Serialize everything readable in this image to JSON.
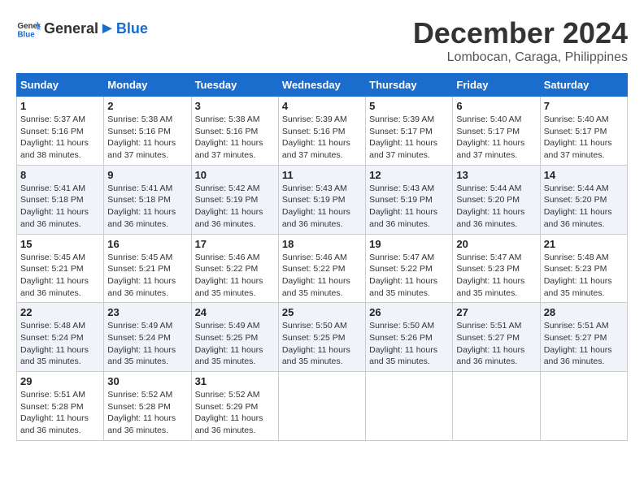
{
  "header": {
    "logo_general": "General",
    "logo_blue": "Blue",
    "month_year": "December 2024",
    "location": "Lombocan, Caraga, Philippines"
  },
  "days_of_week": [
    "Sunday",
    "Monday",
    "Tuesday",
    "Wednesday",
    "Thursday",
    "Friday",
    "Saturday"
  ],
  "weeks": [
    [
      {
        "day": "1",
        "sunrise": "5:37 AM",
        "sunset": "5:16 PM",
        "daylight": "11 hours and 38 minutes."
      },
      {
        "day": "2",
        "sunrise": "5:38 AM",
        "sunset": "5:16 PM",
        "daylight": "11 hours and 37 minutes."
      },
      {
        "day": "3",
        "sunrise": "5:38 AM",
        "sunset": "5:16 PM",
        "daylight": "11 hours and 37 minutes."
      },
      {
        "day": "4",
        "sunrise": "5:39 AM",
        "sunset": "5:16 PM",
        "daylight": "11 hours and 37 minutes."
      },
      {
        "day": "5",
        "sunrise": "5:39 AM",
        "sunset": "5:17 PM",
        "daylight": "11 hours and 37 minutes."
      },
      {
        "day": "6",
        "sunrise": "5:40 AM",
        "sunset": "5:17 PM",
        "daylight": "11 hours and 37 minutes."
      },
      {
        "day": "7",
        "sunrise": "5:40 AM",
        "sunset": "5:17 PM",
        "daylight": "11 hours and 37 minutes."
      }
    ],
    [
      {
        "day": "8",
        "sunrise": "5:41 AM",
        "sunset": "5:18 PM",
        "daylight": "11 hours and 36 minutes."
      },
      {
        "day": "9",
        "sunrise": "5:41 AM",
        "sunset": "5:18 PM",
        "daylight": "11 hours and 36 minutes."
      },
      {
        "day": "10",
        "sunrise": "5:42 AM",
        "sunset": "5:19 PM",
        "daylight": "11 hours and 36 minutes."
      },
      {
        "day": "11",
        "sunrise": "5:43 AM",
        "sunset": "5:19 PM",
        "daylight": "11 hours and 36 minutes."
      },
      {
        "day": "12",
        "sunrise": "5:43 AM",
        "sunset": "5:19 PM",
        "daylight": "11 hours and 36 minutes."
      },
      {
        "day": "13",
        "sunrise": "5:44 AM",
        "sunset": "5:20 PM",
        "daylight": "11 hours and 36 minutes."
      },
      {
        "day": "14",
        "sunrise": "5:44 AM",
        "sunset": "5:20 PM",
        "daylight": "11 hours and 36 minutes."
      }
    ],
    [
      {
        "day": "15",
        "sunrise": "5:45 AM",
        "sunset": "5:21 PM",
        "daylight": "11 hours and 36 minutes."
      },
      {
        "day": "16",
        "sunrise": "5:45 AM",
        "sunset": "5:21 PM",
        "daylight": "11 hours and 36 minutes."
      },
      {
        "day": "17",
        "sunrise": "5:46 AM",
        "sunset": "5:22 PM",
        "daylight": "11 hours and 35 minutes."
      },
      {
        "day": "18",
        "sunrise": "5:46 AM",
        "sunset": "5:22 PM",
        "daylight": "11 hours and 35 minutes."
      },
      {
        "day": "19",
        "sunrise": "5:47 AM",
        "sunset": "5:22 PM",
        "daylight": "11 hours and 35 minutes."
      },
      {
        "day": "20",
        "sunrise": "5:47 AM",
        "sunset": "5:23 PM",
        "daylight": "11 hours and 35 minutes."
      },
      {
        "day": "21",
        "sunrise": "5:48 AM",
        "sunset": "5:23 PM",
        "daylight": "11 hours and 35 minutes."
      }
    ],
    [
      {
        "day": "22",
        "sunrise": "5:48 AM",
        "sunset": "5:24 PM",
        "daylight": "11 hours and 35 minutes."
      },
      {
        "day": "23",
        "sunrise": "5:49 AM",
        "sunset": "5:24 PM",
        "daylight": "11 hours and 35 minutes."
      },
      {
        "day": "24",
        "sunrise": "5:49 AM",
        "sunset": "5:25 PM",
        "daylight": "11 hours and 35 minutes."
      },
      {
        "day": "25",
        "sunrise": "5:50 AM",
        "sunset": "5:25 PM",
        "daylight": "11 hours and 35 minutes."
      },
      {
        "day": "26",
        "sunrise": "5:50 AM",
        "sunset": "5:26 PM",
        "daylight": "11 hours and 35 minutes."
      },
      {
        "day": "27",
        "sunrise": "5:51 AM",
        "sunset": "5:27 PM",
        "daylight": "11 hours and 36 minutes."
      },
      {
        "day": "28",
        "sunrise": "5:51 AM",
        "sunset": "5:27 PM",
        "daylight": "11 hours and 36 minutes."
      }
    ],
    [
      {
        "day": "29",
        "sunrise": "5:51 AM",
        "sunset": "5:28 PM",
        "daylight": "11 hours and 36 minutes."
      },
      {
        "day": "30",
        "sunrise": "5:52 AM",
        "sunset": "5:28 PM",
        "daylight": "11 hours and 36 minutes."
      },
      {
        "day": "31",
        "sunrise": "5:52 AM",
        "sunset": "5:29 PM",
        "daylight": "11 hours and 36 minutes."
      },
      null,
      null,
      null,
      null
    ]
  ]
}
